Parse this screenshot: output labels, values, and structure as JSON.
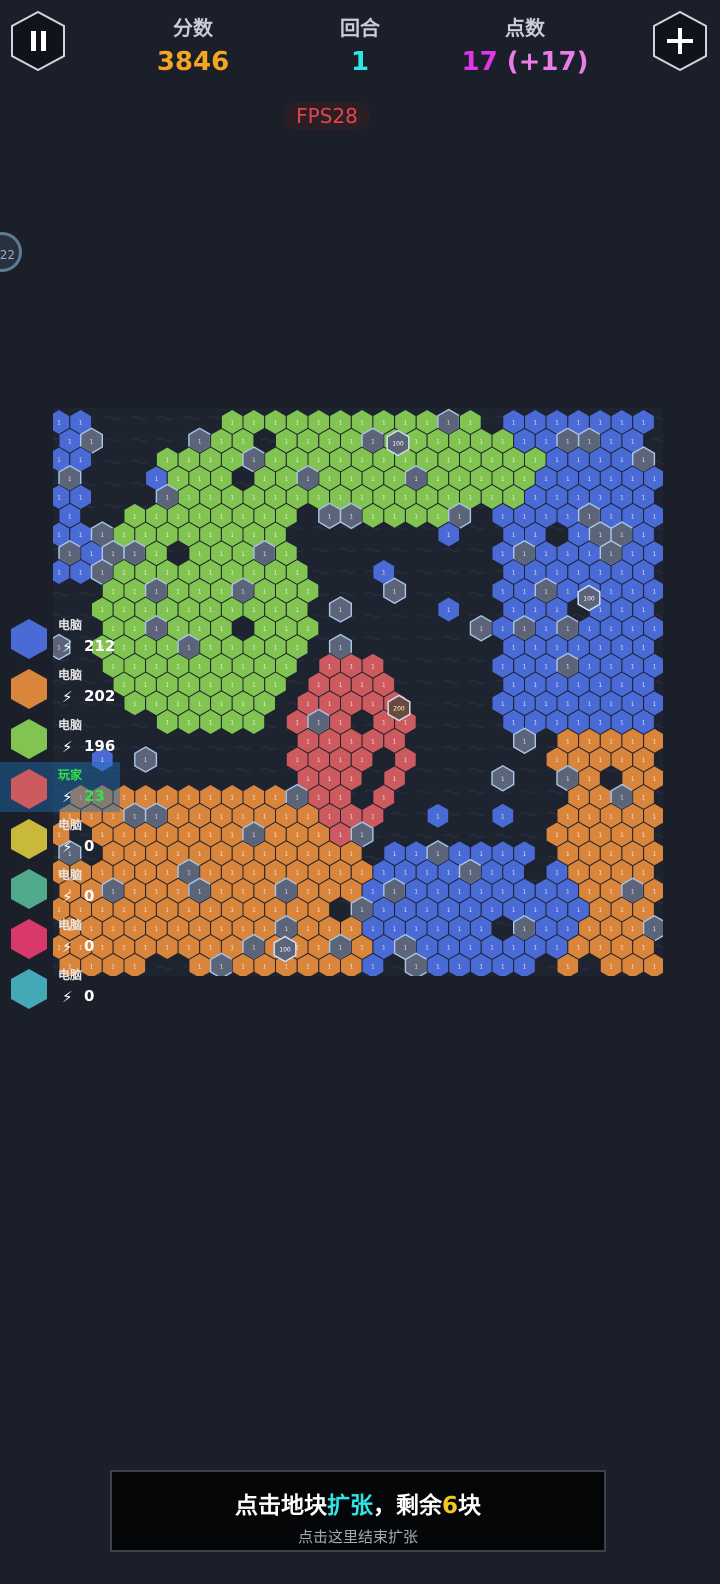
{
  "header": {
    "score_label": "分数",
    "score_value": "3846",
    "round_label": "回合",
    "round_value": "1",
    "points_label": "点数",
    "points_value": "17",
    "points_bonus": "(+17)"
  },
  "fps_text": "FPS28",
  "side_counter": "22",
  "colors": {
    "blue": "#4a6bd6",
    "orange": "#d9853b",
    "green": "#82c451",
    "red": "#cc5a5e",
    "yellow": "#c9b93b",
    "teal": "#4fa98a",
    "pink": "#d8386a",
    "cyan": "#43a9b6",
    "neutral": "#5b6478"
  },
  "players": [
    {
      "name": "电脑",
      "energy": "212",
      "color": "#4a6bd6",
      "active": false
    },
    {
      "name": "电脑",
      "energy": "202",
      "color": "#d9853b",
      "active": false
    },
    {
      "name": "电脑",
      "energy": "196",
      "color": "#82c451",
      "active": false
    },
    {
      "name": "玩家",
      "energy": "23",
      "color": "#cc5a5e",
      "active": true
    },
    {
      "name": "电脑",
      "energy": "0",
      "color": "#c9b93b",
      "active": false
    },
    {
      "name": "电脑",
      "energy": "0",
      "color": "#4fa98a",
      "active": false
    },
    {
      "name": "电脑",
      "energy": "0",
      "color": "#d8386a",
      "active": false
    },
    {
      "name": "电脑",
      "energy": "0",
      "color": "#43a9b6",
      "active": false
    }
  ],
  "board": {
    "tile_value": "1",
    "special_values": [
      "100",
      "200"
    ]
  },
  "expand_panel": {
    "prefix": "点击地块",
    "highlight": "扩张",
    "middle": "，剩余",
    "count": "6",
    "suffix": "块",
    "subtitle": "点击这里结束扩张"
  }
}
